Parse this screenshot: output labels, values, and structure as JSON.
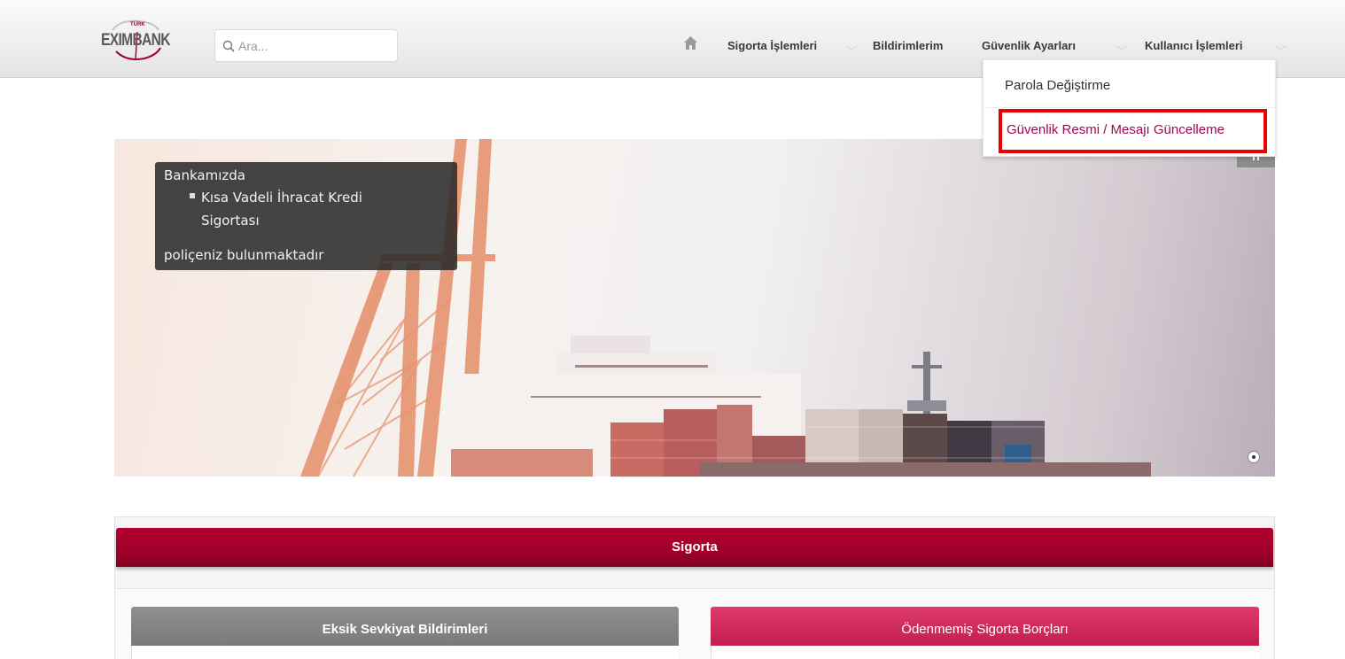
{
  "header": {
    "logo": {
      "small_text": "TÜRK",
      "brand_text": "EXIMBANK"
    },
    "search": {
      "placeholder": "Ara..."
    },
    "nav": {
      "home_icon": "home-icon",
      "items": [
        {
          "label": "Sigorta İşlemleri"
        },
        {
          "label": "Bildirimlerim"
        },
        {
          "label": "Güvenlik Ayarları"
        },
        {
          "label": "Kullanıcı İşlemleri"
        }
      ]
    },
    "dropdown": {
      "items": [
        {
          "label": "Parola Değiştirme"
        },
        {
          "label": "Güvenlik Resmi / Mesajı Güncelleme"
        }
      ],
      "highlight_color": "#ee0000"
    }
  },
  "hero": {
    "caption": {
      "line1": "Bankamızda",
      "bullet_line1": "Kısa Vadeli İhracat Kredi",
      "bullet_line2": "Sigortası",
      "line2": "poliçeniz bulunmaktadır"
    }
  },
  "panel": {
    "title": "Sigorta",
    "cards": [
      {
        "title": "Eksik Sevkiyat Bildirimleri"
      },
      {
        "title": "Ödenmemiş Sigorta Borçları"
      }
    ],
    "accent_color": "#9c0028"
  }
}
